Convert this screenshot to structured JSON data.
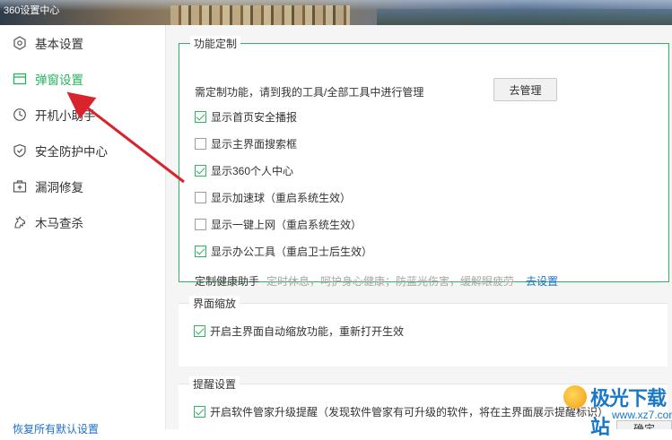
{
  "window": {
    "title": "360设置中心"
  },
  "sidebar": {
    "items": [
      {
        "label": "基本设置",
        "icon": "gear-icon"
      },
      {
        "label": "弹窗设置",
        "icon": "popup-window-icon",
        "active": true
      },
      {
        "label": "开机小助手",
        "icon": "clock-icon"
      },
      {
        "label": "安全防护中心",
        "icon": "shield-icon"
      },
      {
        "label": "漏洞修复",
        "icon": "repair-kit-icon"
      },
      {
        "label": "木马查杀",
        "icon": "horse-icon"
      }
    ],
    "reset_label": "恢复所有默认设置"
  },
  "feature_custom": {
    "title": "功能定制",
    "note": "需定制功能，请到我的工具/全部工具中进行管理",
    "manage_button": "去管理",
    "options": [
      {
        "label": "显示首页安全播报",
        "checked": true
      },
      {
        "label": "显示主界面搜索框",
        "checked": false
      },
      {
        "label": "显示360个人中心",
        "checked": true
      },
      {
        "label": "显示加速球（重启系统生效）",
        "checked": false
      },
      {
        "label": "显示一键上网（重启系统生效）",
        "checked": false
      },
      {
        "label": "显示办公工具（重启卫士后生效）",
        "checked": true
      }
    ],
    "health_label": "定制健康助手",
    "health_desc": "定时休息，呵护身心健康；防蓝光伤害，缓解眼疲劳",
    "health_link": "去设置"
  },
  "zoom": {
    "title": "界面缩放",
    "option": {
      "label": "开启主界面自动缩放功能，重新打开生效",
      "checked": true
    }
  },
  "reminder": {
    "title": "提醒设置",
    "option": {
      "label": "开启软件管家升级提醒（发现软件管家有可升级的软件，将在主界面展示提醒标识）",
      "checked": true
    }
  },
  "footer": {
    "confirm_label": "确定"
  },
  "watermark": {
    "text": "极光下载站",
    "url": "www.xz7.com"
  },
  "colors": {
    "accent": "#2fb463",
    "link": "#1f6fcb",
    "arrow": "#d9232d"
  }
}
